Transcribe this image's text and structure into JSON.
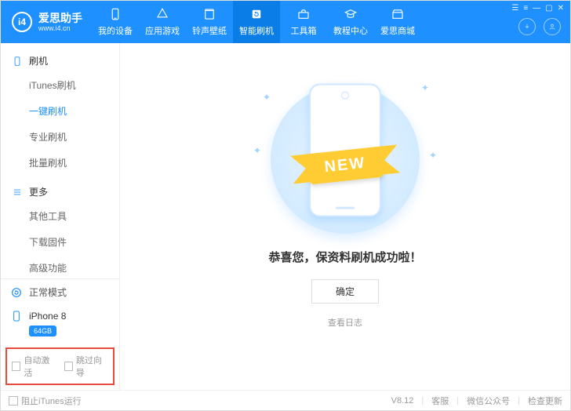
{
  "brand": {
    "logo_text": "i4",
    "title": "爱思助手",
    "url": "www.i4.cn"
  },
  "tabs": [
    {
      "label": "我的设备"
    },
    {
      "label": "应用游戏"
    },
    {
      "label": "铃声壁纸"
    },
    {
      "label": "智能刷机"
    },
    {
      "label": "工具箱"
    },
    {
      "label": "教程中心"
    },
    {
      "label": "爱思商城"
    }
  ],
  "sidebar": {
    "section_flash": "刷机",
    "items_flash": [
      "iTunes刷机",
      "一键刷机",
      "专业刷机",
      "批量刷机"
    ],
    "section_more": "更多",
    "items_more": [
      "其他工具",
      "下载固件",
      "高级功能"
    ],
    "mode": "正常模式",
    "device_name": "iPhone 8",
    "device_capacity": "64GB",
    "check_auto": "自动激活",
    "check_skip": "跳过向导"
  },
  "main": {
    "ribbon": "NEW",
    "success": "恭喜您，保资料刷机成功啦！",
    "ok": "确定",
    "view_log": "查看日志"
  },
  "footer": {
    "block_itunes": "阻止iTunes运行",
    "version": "V8.12",
    "support": "客服",
    "wechat": "微信公众号",
    "update": "检查更新"
  }
}
